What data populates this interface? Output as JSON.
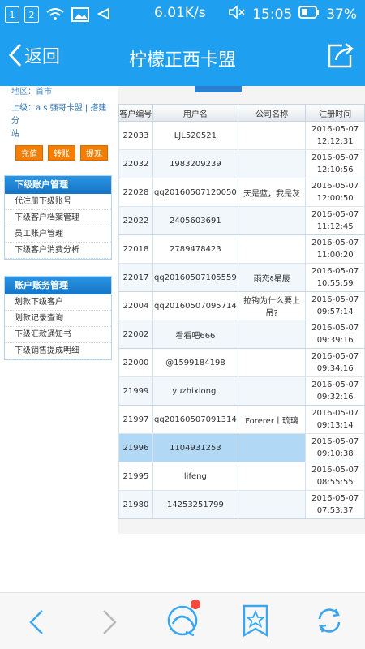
{
  "status": {
    "sim1": "1",
    "sim2": "2",
    "speed": "6.01K/s",
    "time": "15:05",
    "battery": "37%"
  },
  "header": {
    "back_label": "返回",
    "title": "柠檬正西卡盟"
  },
  "sidebar": {
    "info_top": "地区：首市",
    "info_line1": "上级：a s 强哥卡盟 | 搭建分",
    "info_line2": "站",
    "buttons": [
      "充值",
      "转账",
      "提现"
    ],
    "panels": [
      {
        "title": "下级账户管理",
        "items": [
          "代注册下级账号",
          "下级客户档案管理",
          "员工账户管理",
          "下级客户消费分析"
        ]
      },
      {
        "title": "账户账务管理",
        "items": [
          "划款下级客户",
          "划款记录查询",
          "下级汇款通知书",
          "下级销售提成明细"
        ]
      }
    ]
  },
  "table": {
    "headers": [
      "客户编号",
      "用户名",
      "公司名称",
      "注册时间"
    ],
    "rows": [
      {
        "id": "22033",
        "username": "LJL520521",
        "company": "",
        "date": "2016-05-07",
        "time": "12:12:31"
      },
      {
        "id": "22032",
        "username": "1983209239",
        "company": "",
        "date": "2016-05-07",
        "time": "12:10:56"
      },
      {
        "id": "22028",
        "username": "qq20160507120050",
        "company": "天是蓝，我是灰",
        "date": "2016-05-07",
        "time": "12:00:50"
      },
      {
        "id": "22022",
        "username": "2405603691",
        "company": "",
        "date": "2016-05-07",
        "time": "11:12:45"
      },
      {
        "id": "22018",
        "username": "2789478423",
        "company": "",
        "date": "2016-05-07",
        "time": "11:00:20"
      },
      {
        "id": "22017",
        "username": "qq20160507105559",
        "company": "雨恋§星辰",
        "date": "2016-05-07",
        "time": "10:55:59"
      },
      {
        "id": "22004",
        "username": "qq20160507095714",
        "company": "拉钩为什么要上吊?",
        "date": "2016-05-07",
        "time": "09:57:14"
      },
      {
        "id": "22002",
        "username": "看看吧666",
        "company": "",
        "date": "2016-05-07",
        "time": "09:39:16"
      },
      {
        "id": "22000",
        "username": "@1599184198",
        "company": "",
        "date": "2016-05-07",
        "time": "09:34:16"
      },
      {
        "id": "21999",
        "username": "yuzhixiong.",
        "company": "",
        "date": "2016-05-07",
        "time": "09:32:16"
      },
      {
        "id": "21997",
        "username": "qq20160507091314",
        "company": "Forerer丨琉璃",
        "date": "2016-05-07",
        "time": "09:13:14"
      },
      {
        "id": "21996",
        "username": "1104931253",
        "company": "",
        "date": "2016-05-07",
        "time": "09:10:38"
      },
      {
        "id": "21995",
        "username": "lifeng",
        "company": "",
        "date": "2016-05-07",
        "time": "08:55:55"
      },
      {
        "id": "21980",
        "username": "14253251799",
        "company": "",
        "date": "2016-05-07",
        "time": "07:53:37"
      }
    ]
  },
  "colors": {
    "accent": "#1e9ff0",
    "selected_row": "#b1d8f5",
    "orange_button": "#f57e00",
    "badge": "#f24b3e"
  },
  "bottom_nav": [
    "back-icon",
    "forward-icon",
    "browser-home-icon",
    "bookmark-star-icon",
    "refresh-icon"
  ]
}
